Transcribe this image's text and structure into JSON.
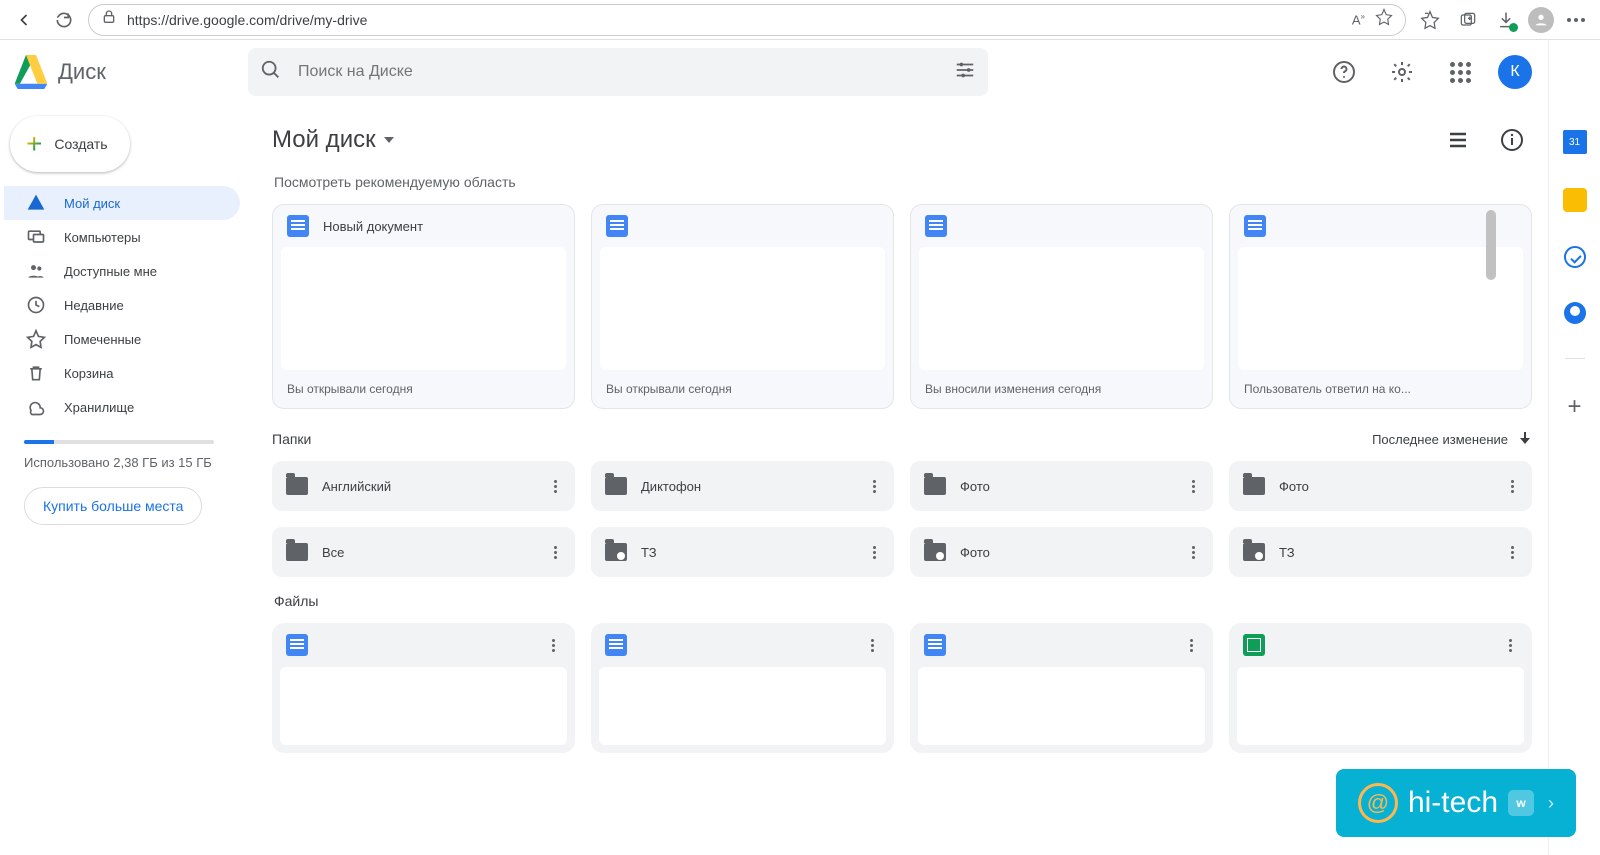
{
  "browser": {
    "url": "https://drive.google.com/drive/my-drive"
  },
  "brand": "Диск",
  "search": {
    "placeholder": "Поиск на Диске"
  },
  "user_avatar_letter": "К",
  "create_button": "Создать",
  "nav": {
    "my_drive": "Мой диск",
    "computers": "Компьютеры",
    "shared": "Доступные мне",
    "recent": "Недавние",
    "starred": "Помеченные",
    "trash": "Корзина",
    "storage": "Хранилище"
  },
  "storage": {
    "used_text": "Использовано 2,38 ГБ из 15 ГБ",
    "buy_button": "Купить больше места",
    "fill_percent": 16
  },
  "breadcrumb": "Мой диск",
  "suggested_label": "Посмотреть рекомендуемую область",
  "suggested": [
    {
      "title": "Новый документ",
      "reason": "Вы открывали сегодня",
      "type": "doc"
    },
    {
      "title": "",
      "reason": "Вы открывали сегодня",
      "type": "doc"
    },
    {
      "title": "",
      "reason": "Вы вносили изменения сегодня",
      "type": "doc"
    },
    {
      "title": "",
      "reason": "Пользователь            ответил на ко...",
      "type": "doc"
    }
  ],
  "folders_label": "Папки",
  "sort_label": "Последнее изменение",
  "folders_row1": [
    {
      "name": "Английский",
      "shared": false
    },
    {
      "name": "Диктофон",
      "shared": false
    },
    {
      "name": "Фото",
      "shared": false
    },
    {
      "name": "Фото",
      "shared": false
    }
  ],
  "folders_row2": [
    {
      "name": "Все",
      "shared": false
    },
    {
      "name": "ТЗ",
      "shared": true
    },
    {
      "name": "Фото",
      "shared": true
    },
    {
      "name": "ТЗ",
      "shared": true
    }
  ],
  "files_label": "Файлы",
  "files": [
    {
      "type": "doc"
    },
    {
      "type": "doc"
    },
    {
      "type": "doc"
    },
    {
      "type": "sheet"
    }
  ],
  "watermark": {
    "text": "hi-tech",
    "badge": "w"
  }
}
